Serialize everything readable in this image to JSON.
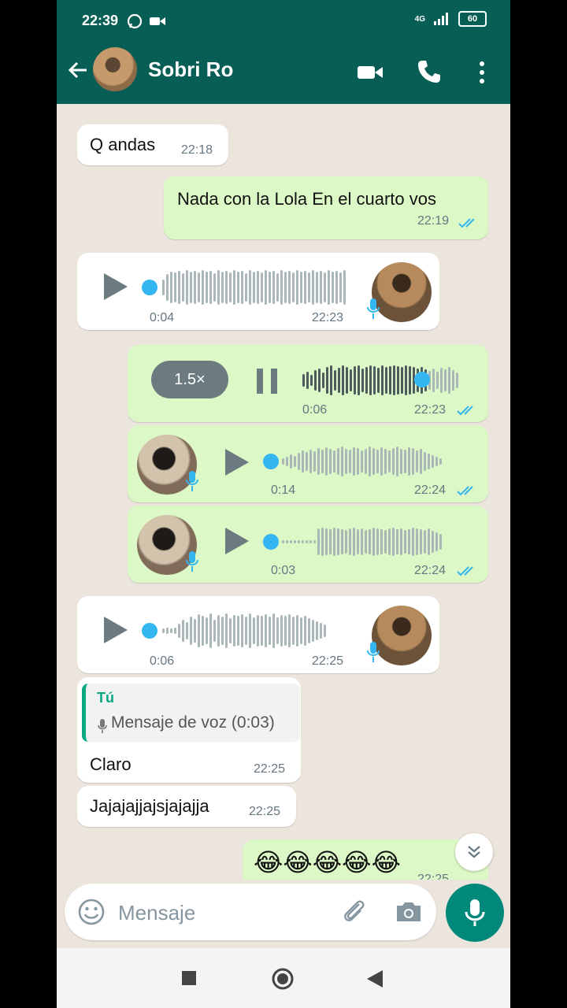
{
  "status_bar": {
    "time": "22:39",
    "network": "4G",
    "battery": "60"
  },
  "header": {
    "contact_name": "Sobri Ro",
    "back_icon": "arrow-left-icon",
    "video_icon": "video-call-icon",
    "call_icon": "phone-icon",
    "menu_icon": "more-vert-icon"
  },
  "messages": [
    {
      "type": "text",
      "dir": "in",
      "text": "Q andas",
      "time": "22:18"
    },
    {
      "type": "text",
      "dir": "out",
      "text": "Nada con la Lola En el cuarto vos",
      "time": "22:19"
    },
    {
      "type": "voice",
      "dir": "in",
      "duration": "0:04",
      "time": "22:23"
    },
    {
      "type": "voice",
      "dir": "out",
      "speed": "1.5×",
      "duration": "0:06",
      "time": "22:23",
      "progress": 0.8
    },
    {
      "type": "voice",
      "dir": "out",
      "duration": "0:14",
      "time": "22:24"
    },
    {
      "type": "voice",
      "dir": "out",
      "duration": "0:03",
      "time": "22:24"
    },
    {
      "type": "voice",
      "dir": "in",
      "duration": "0:06",
      "time": "22:25"
    },
    {
      "type": "reply",
      "dir": "in",
      "quote_author": "Tú",
      "quote_text": "Mensaje de voz (0:03)",
      "text": "Claro",
      "time": "22:25"
    },
    {
      "type": "text",
      "dir": "in",
      "text": "Jajajajjajsjajajja",
      "time": "22:25"
    },
    {
      "type": "emoji",
      "dir": "out",
      "text": "😂😂😂😂😂",
      "time": "22:25"
    }
  ],
  "composer": {
    "placeholder": "Mensaje",
    "emoji_icon": "emoji-icon",
    "attach_icon": "paperclip-icon",
    "camera_icon": "camera-icon",
    "mic_icon": "mic-icon"
  },
  "colors": {
    "header": "#075e54",
    "outgoing": "#dcf8c6",
    "incoming": "#ffffff",
    "read_ticks": "#34b7f1",
    "mic_button": "#00897b"
  }
}
